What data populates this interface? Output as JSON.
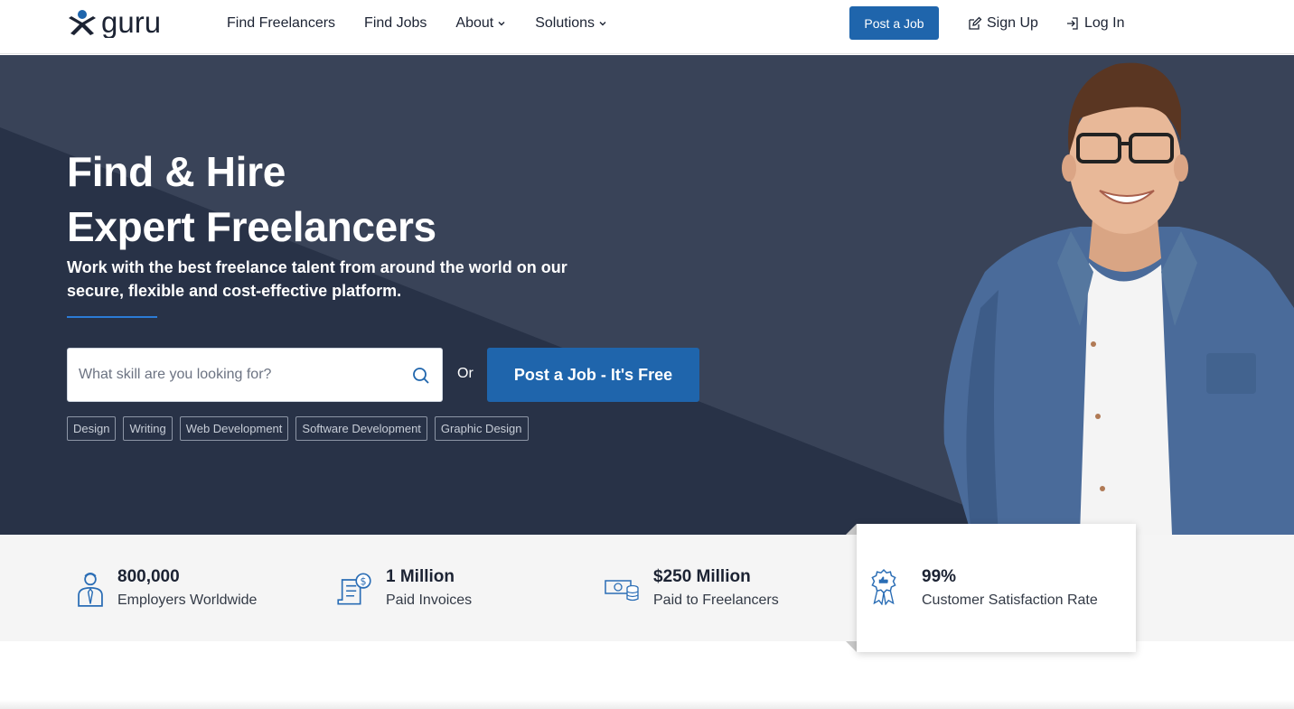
{
  "header": {
    "logo_text": "guru",
    "nav": [
      {
        "label": "Find Freelancers",
        "dropdown": false
      },
      {
        "label": "Find Jobs",
        "dropdown": false
      },
      {
        "label": "About",
        "dropdown": true
      },
      {
        "label": "Solutions",
        "dropdown": true
      }
    ],
    "post_job_label": "Post a Job",
    "signup_label": "Sign Up",
    "login_label": "Log In"
  },
  "hero": {
    "title_line1": "Find & Hire",
    "title_line2": "Expert Freelancers",
    "subtitle": "Work with the best freelance talent from around the world on our secure, flexible and cost-effective platform.",
    "search_placeholder": "What skill are you looking for?",
    "search_value": "",
    "or_text": "Or",
    "post_job_cta": "Post a Job - It's Free",
    "tags": [
      "Design",
      "Writing",
      "Web Development",
      "Software Development",
      "Graphic Design"
    ]
  },
  "stats": [
    {
      "value": "800,000",
      "label": "Employers Worldwide",
      "icon": "employer-icon"
    },
    {
      "value": "1 Million",
      "label": "Paid Invoices",
      "icon": "invoice-icon"
    },
    {
      "value": "$250 Million",
      "label": "Paid to Freelancers",
      "icon": "money-icon"
    },
    {
      "value": "99%",
      "label": "Customer Satisfaction Rate",
      "icon": "award-icon"
    }
  ],
  "colors": {
    "brand_blue": "#1f65ac",
    "hero_dark": "#283247",
    "hero_light": "#3a4459",
    "accent_rule": "#2b7bd6",
    "icon_blue": "#2a6db5",
    "stats_bg": "#f5f5f5"
  }
}
